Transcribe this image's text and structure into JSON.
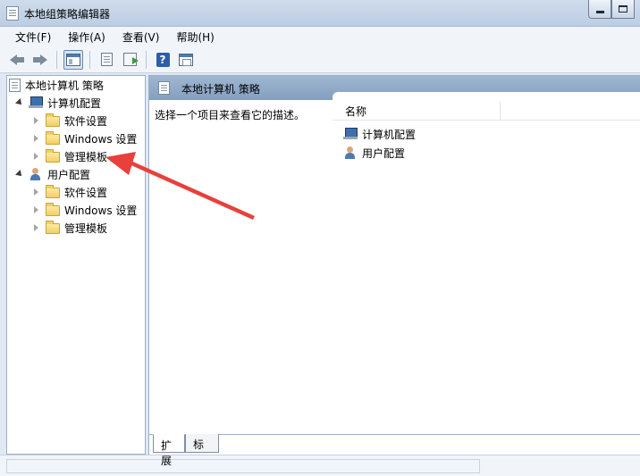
{
  "window": {
    "title": "本地组策略编辑器"
  },
  "menu": [
    "文件(F)",
    "操作(A)",
    "查看(V)",
    "帮助(H)"
  ],
  "tree": [
    {
      "label": "本地计算机 策略",
      "icon": "policy-icon",
      "expander": "none"
    },
    {
      "label": "计算机配置",
      "icon": "computer-icon",
      "expander": "open"
    },
    {
      "label": "软件设置",
      "icon": "folder-icon",
      "expander": "closed"
    },
    {
      "label": "Windows 设置",
      "icon": "folder-icon",
      "expander": "closed"
    },
    {
      "label": "管理模板",
      "icon": "folder-icon",
      "expander": "closed"
    },
    {
      "label": "用户配置",
      "icon": "user-icon",
      "expander": "open"
    },
    {
      "label": "软件设置",
      "icon": "folder-icon",
      "expander": "closed"
    },
    {
      "label": "Windows 设置",
      "icon": "folder-icon",
      "expander": "closed"
    },
    {
      "label": "管理模板",
      "icon": "folder-icon",
      "expander": "closed"
    }
  ],
  "details": {
    "header_title": "本地计算机 策略",
    "description": "选择一个项目来查看它的描述。",
    "column_name": "名称",
    "items": [
      {
        "label": "计算机配置",
        "icon": "computer-icon"
      },
      {
        "label": "用户配置",
        "icon": "user-icon"
      }
    ]
  },
  "tabs": [
    "扩展",
    "标准"
  ],
  "colors": {
    "annotation_arrow": "#e8403c",
    "details_header": "#90aac8"
  }
}
